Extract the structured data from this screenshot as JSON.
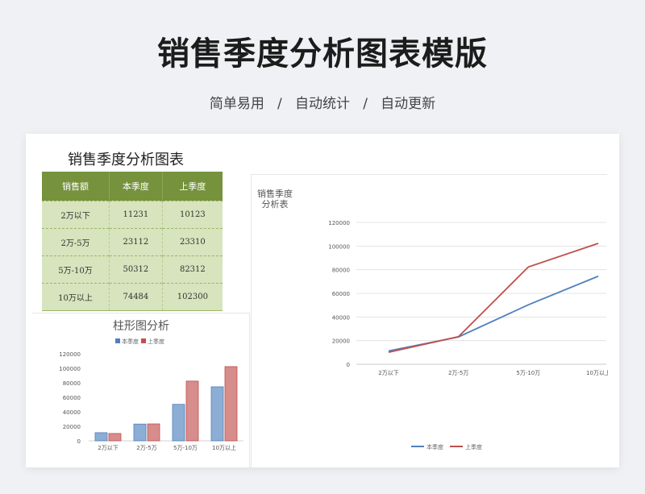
{
  "header": {
    "title": "销售季度分析图表模版",
    "subtitle": [
      "简单易用",
      "自动统计",
      "自动更新"
    ]
  },
  "table": {
    "title": "销售季度分析图表",
    "headers": [
      "销售额",
      "本季度",
      "上季度"
    ],
    "rows": [
      [
        "2万以下",
        "11231",
        "10123"
      ],
      [
        "2万-5万",
        "23112",
        "23310"
      ],
      [
        "5万-10万",
        "50312",
        "82312"
      ],
      [
        "10万以上",
        "74484",
        "102300"
      ]
    ]
  },
  "colors": {
    "header_green": "#76923c",
    "cell_green": "#d7e4bd",
    "series_blue": "#4f81bd",
    "series_red": "#c0504d"
  },
  "chart_data": [
    {
      "type": "bar",
      "title": "柱形图分析",
      "categories": [
        "2万以下",
        "2万-5万",
        "5万-10万",
        "10万以上"
      ],
      "series": [
        {
          "name": "本季度",
          "values": [
            11231,
            23112,
            50312,
            74484
          ],
          "color": "#4f81bd"
        },
        {
          "name": "上季度",
          "values": [
            10123,
            23310,
            82312,
            102300
          ],
          "color": "#c0504d"
        }
      ],
      "yticks": [
        "0",
        "20000",
        "40000",
        "60000",
        "80000",
        "100000",
        "120000"
      ],
      "ylim": [
        0,
        120000
      ],
      "legend": "top",
      "grid": false
    },
    {
      "type": "line",
      "title": "销售季度分析表",
      "categories": [
        "2万以下",
        "2万-5万",
        "5万-10万",
        "10万以上"
      ],
      "series": [
        {
          "name": "本季度",
          "values": [
            11231,
            23112,
            50312,
            74484
          ],
          "color": "#4f81bd"
        },
        {
          "name": "上季度",
          "values": [
            10123,
            23310,
            82312,
            102300
          ],
          "color": "#c0504d"
        }
      ],
      "yticks": [
        "0",
        "20000",
        "40000",
        "60000",
        "80000",
        "100000",
        "120000"
      ],
      "ylim": [
        0,
        120000
      ],
      "legend": "bottom",
      "grid": true
    }
  ]
}
